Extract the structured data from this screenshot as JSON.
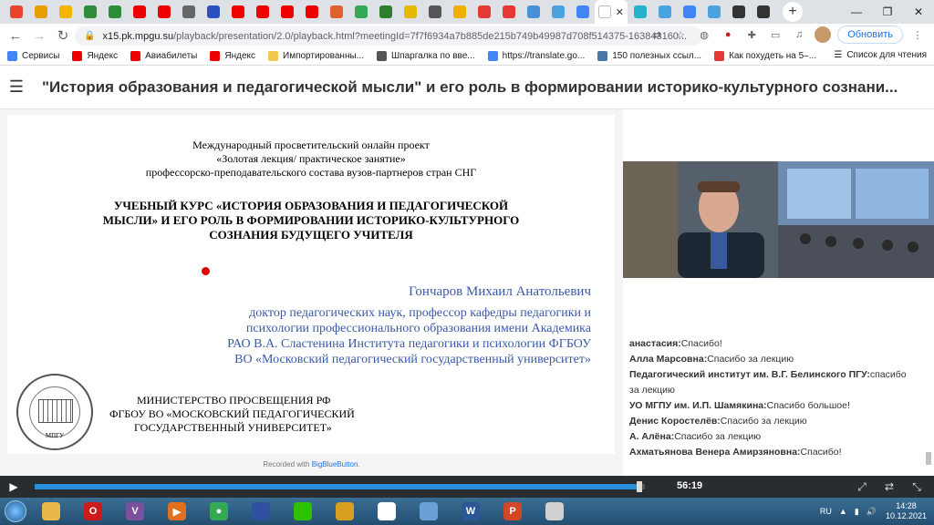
{
  "browser": {
    "tabs": [
      {
        "icon": "windows-icon",
        "color": "#e8452c"
      },
      {
        "icon": "alert-icon",
        "color": "#e5a000"
      },
      {
        "icon": "pencil-icon",
        "color": "#f3b400"
      },
      {
        "icon": "tree-icon",
        "color": "#2e8b3a"
      },
      {
        "icon": "tree-icon",
        "color": "#2e8b3a"
      },
      {
        "icon": "youtube-icon",
        "color": "#e00"
      },
      {
        "icon": "youtube-icon",
        "color": "#e00"
      },
      {
        "icon": "window-icon",
        "color": "#666"
      },
      {
        "icon": "globe-icon",
        "color": "#2a52be"
      },
      {
        "icon": "youtube-icon",
        "color": "#e00"
      },
      {
        "icon": "youtube-icon",
        "color": "#e00"
      },
      {
        "icon": "youtube-icon",
        "color": "#e00"
      },
      {
        "icon": "youtube-icon",
        "color": "#e00"
      },
      {
        "icon": "tag-icon",
        "color": "#e06030"
      },
      {
        "icon": "google-icon",
        "color": "#34a853"
      },
      {
        "icon": "chat-icon",
        "color": "#2e7d32"
      },
      {
        "icon": "crown-icon",
        "color": "#e6b800"
      },
      {
        "icon": "globe-icon",
        "color": "#555"
      },
      {
        "icon": "star-icon",
        "color": "#f0b000"
      },
      {
        "icon": "location-icon",
        "color": "#e53935"
      },
      {
        "icon": "location-icon",
        "color": "#e53935"
      },
      {
        "icon": "image-icon",
        "color": "#4a90d9"
      },
      {
        "icon": "bookmark-icon",
        "color": "#4aa3df"
      },
      {
        "icon": "google-icon",
        "color": "#4285f4"
      }
    ],
    "tabs_after": [
      {
        "icon": "bookmark-icon",
        "color": "#27b1c9"
      },
      {
        "icon": "bookmark-icon",
        "color": "#4aa3df"
      },
      {
        "icon": "google-icon",
        "color": "#4285f4"
      },
      {
        "icon": "bookmark-icon",
        "color": "#4aa3df"
      },
      {
        "icon": "d-icon",
        "color": "#333"
      },
      {
        "icon": "d-icon",
        "color": "#333"
      }
    ],
    "close_glyph": "✕",
    "new_tab_glyph": "+",
    "url_host": "x15.pk.mpgu.su",
    "url_path": "/playback/presentation/2.0/playback.html?meetingId=7f7f6934a7b885de215b749b49987d708f514375-163843160...",
    "update_button": "Обновить",
    "bookmarks": [
      {
        "label": "Сервисы",
        "color": "#4285f4"
      },
      {
        "label": "Яндекс",
        "color": "#e00"
      },
      {
        "label": "Авиабилеты",
        "color": "#e00"
      },
      {
        "label": "Яндекс",
        "color": "#e00"
      },
      {
        "label": "Импортированны...",
        "color": "#f2c94c"
      },
      {
        "label": "Шпаргалка по вве...",
        "color": "#555"
      },
      {
        "label": "https://translate.go...",
        "color": "#4285f4"
      },
      {
        "label": "150 полезных ссыл...",
        "color": "#4a76a8"
      },
      {
        "label": "Как похудеть на 5–...",
        "color": "#e53935"
      }
    ],
    "reading_list": "Список для чтения"
  },
  "presentation": {
    "title": "\"История образования и педагогической мысли\" и его роль в формировании историко-культурного сознани...",
    "slide": {
      "intro": [
        "Международный просветительский онлайн проект",
        "«Золотая лекция/ практическое занятие»",
        "профессорско-преподавательского состава вузов-партнеров стран СНГ"
      ],
      "course_title": [
        "УЧЕБНЫЙ КУРС «ИСТОРИЯ ОБРАЗОВАНИЯ И ПЕДАГОГИЧЕСКОЙ",
        "МЫСЛИ» И ЕГО РОЛЬ В ФОРМИРОВАНИИ ИСТОРИКО-КУЛЬТУРНОГО",
        "СОЗНАНИЯ БУДУЩЕГО УЧИТЕЛЯ"
      ],
      "author": "Гончаров Михаил Анатольевич",
      "author_info": [
        "доктор педагогических наук, профессор кафедры педагогики и",
        "психологии профессионального образования имени Академика",
        "РАО В.А. Сластенина Института педагогики и психологии ФГБОУ",
        "ВО «Московский педагогический государственный университет»"
      ],
      "ministry": [
        "МИНИСТЕРСТВО ПРОСВЕЩЕНИЯ РФ",
        "ФГБОУ ВО «МОСКОВСКИЙ ПЕДАГОГИЧЕСКИЙ",
        "ГОСУДАРСТВЕННЫЙ УНИВЕРСИТЕТ»"
      ],
      "seal_label": "МПГУ"
    },
    "recorded_prefix": "Recorded with ",
    "recorded_link": "BigBlueButton",
    "recorded_suffix": "."
  },
  "chat": [
    {
      "author": "анастасия:",
      "text": "Спасибо!"
    },
    {
      "author": "Алла Марсовна:",
      "text": "Спасибо за лекцию"
    },
    {
      "author": "Педагогический институт им. В.Г. Белинского ПГУ:",
      "text": "спасибо за лекцию"
    },
    {
      "author": "УО МГПУ им. И.П. Шамякина:",
      "text": "Спасибо большое!"
    },
    {
      "author": "Денис Коростелёв:",
      "text": "Спасибо за лекцию"
    },
    {
      "author": "А. Алёна:",
      "text": "Спасибо за лекцию"
    },
    {
      "author": "Ахматьянова Венера Амирзяновна:",
      "text": "Спасибо!"
    }
  ],
  "player": {
    "time": "56:19",
    "progress_fraction": 0.995,
    "play_glyph": "▶"
  },
  "taskbar": {
    "apps": [
      {
        "icon": "folder-icon",
        "color": "#e8b94a",
        "glyph": ""
      },
      {
        "icon": "opera-icon",
        "color": "#d01a1a",
        "glyph": "O"
      },
      {
        "icon": "viber-icon",
        "color": "#7b519d",
        "glyph": "V"
      },
      {
        "icon": "media-player-icon",
        "color": "#e07020",
        "glyph": "▶"
      },
      {
        "icon": "chrome-icon",
        "color": "#34a853",
        "glyph": "●"
      },
      {
        "icon": "save-icon",
        "color": "#3050a0",
        "glyph": ""
      },
      {
        "icon": "wechat-icon",
        "color": "#2dc100",
        "glyph": ""
      },
      {
        "icon": "game-icon",
        "color": "#d8a020",
        "glyph": ""
      },
      {
        "icon": "cards-icon",
        "color": "#ffffff",
        "glyph": ""
      },
      {
        "icon": "paint-icon",
        "color": "#6aa0d8",
        "glyph": ""
      },
      {
        "icon": "word-icon",
        "color": "#2b5797",
        "glyph": "W"
      },
      {
        "icon": "powerpoint-icon",
        "color": "#d24726",
        "glyph": "P"
      },
      {
        "icon": "search-tool-icon",
        "color": "#d0d0d0",
        "glyph": ""
      }
    ],
    "lang": "RU",
    "time": "14:28",
    "date": "10.12.2021"
  }
}
